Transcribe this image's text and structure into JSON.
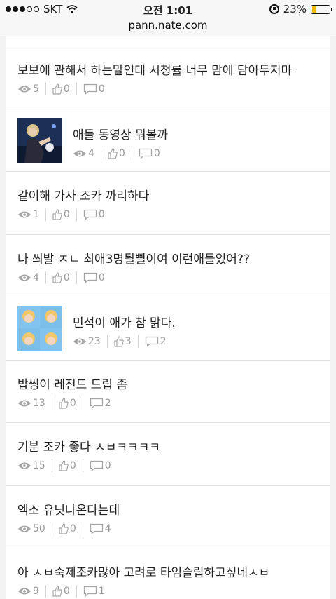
{
  "status_bar": {
    "carrier": "SKT",
    "time": "오전 1:01",
    "battery": "23%",
    "battery_level": 0.23
  },
  "url": "pann.nate.com",
  "posts": [
    {
      "title": "보보에 관해서 하는말인데 시청률 너무 맘에 담아두지마",
      "views": "5",
      "likes": "0",
      "comments": "0",
      "thumb": null
    },
    {
      "title": "애들 동영상 뭐볼까",
      "views": "4",
      "likes": "0",
      "comments": "0",
      "thumb": "stage-photo"
    },
    {
      "title": "같이해 가사 조카 까리하다",
      "views": "1",
      "likes": "0",
      "comments": "0",
      "thumb": null
    },
    {
      "title": "나 씌발 ㅈㄴ 최애3명될삘이여 이런애들있어??",
      "views": "4",
      "likes": "0",
      "comments": "0",
      "thumb": null
    },
    {
      "title": "민석이 애가 참 맑다.",
      "views": "23",
      "likes": "3",
      "comments": "2",
      "thumb": "grid-photo"
    },
    {
      "title": "밥씽이 레전드 드립 좀",
      "views": "13",
      "likes": "0",
      "comments": "2",
      "thumb": null
    },
    {
      "title": "기분 조카 좋다 ㅅㅂㅋㅋㅋㅋ",
      "views": "15",
      "likes": "0",
      "comments": "0",
      "thumb": null
    },
    {
      "title": "엑소 유닛나온다는데",
      "views": "50",
      "likes": "0",
      "comments": "4",
      "thumb": null
    },
    {
      "title": "아 ㅅㅂ숙제조카많아 고려로 타임슬립하고싶네ㅅㅂ",
      "views": "9",
      "likes": "0",
      "comments": "1",
      "thumb": null
    }
  ]
}
